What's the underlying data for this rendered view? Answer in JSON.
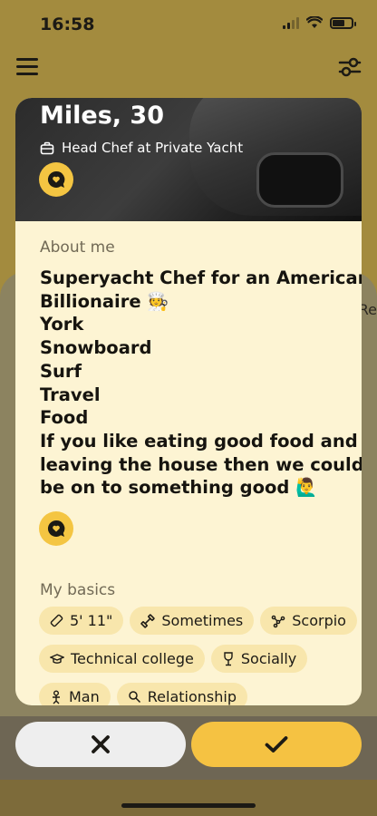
{
  "status_bar": {
    "time": "16:58"
  },
  "profile": {
    "name": "Miles, 30",
    "job": "Head Chef at Private Yacht",
    "about_title": "About me",
    "about_lines": [
      "Superyacht Chef for an American",
      "Billionaire 🧑‍🍳",
      "York",
      "Snowboard",
      "Surf",
      "Travel",
      "Food",
      "If you like eating good food and",
      "leaving the house then we could",
      "be on to something good 🙋‍♂️"
    ],
    "basics_title": "My basics",
    "basics": [
      {
        "icon": "ruler-icon",
        "label": "5' 11\""
      },
      {
        "icon": "dumbbell-icon",
        "label": "Sometimes"
      },
      {
        "icon": "zodiac-icon",
        "label": "Scorpio"
      },
      {
        "icon": "graduation-cap-icon",
        "label": "Technical college"
      },
      {
        "icon": "wine-glass-icon",
        "label": "Socially"
      },
      {
        "icon": "gender-icon",
        "label": "Man"
      },
      {
        "icon": "magnifier-icon",
        "label": "Relationship"
      }
    ]
  },
  "background": {
    "side_text": "Re"
  },
  "colors": {
    "accent": "#f5c242",
    "card_bg": "#fdf4d3",
    "chip_bg": "#f8e6ac"
  }
}
